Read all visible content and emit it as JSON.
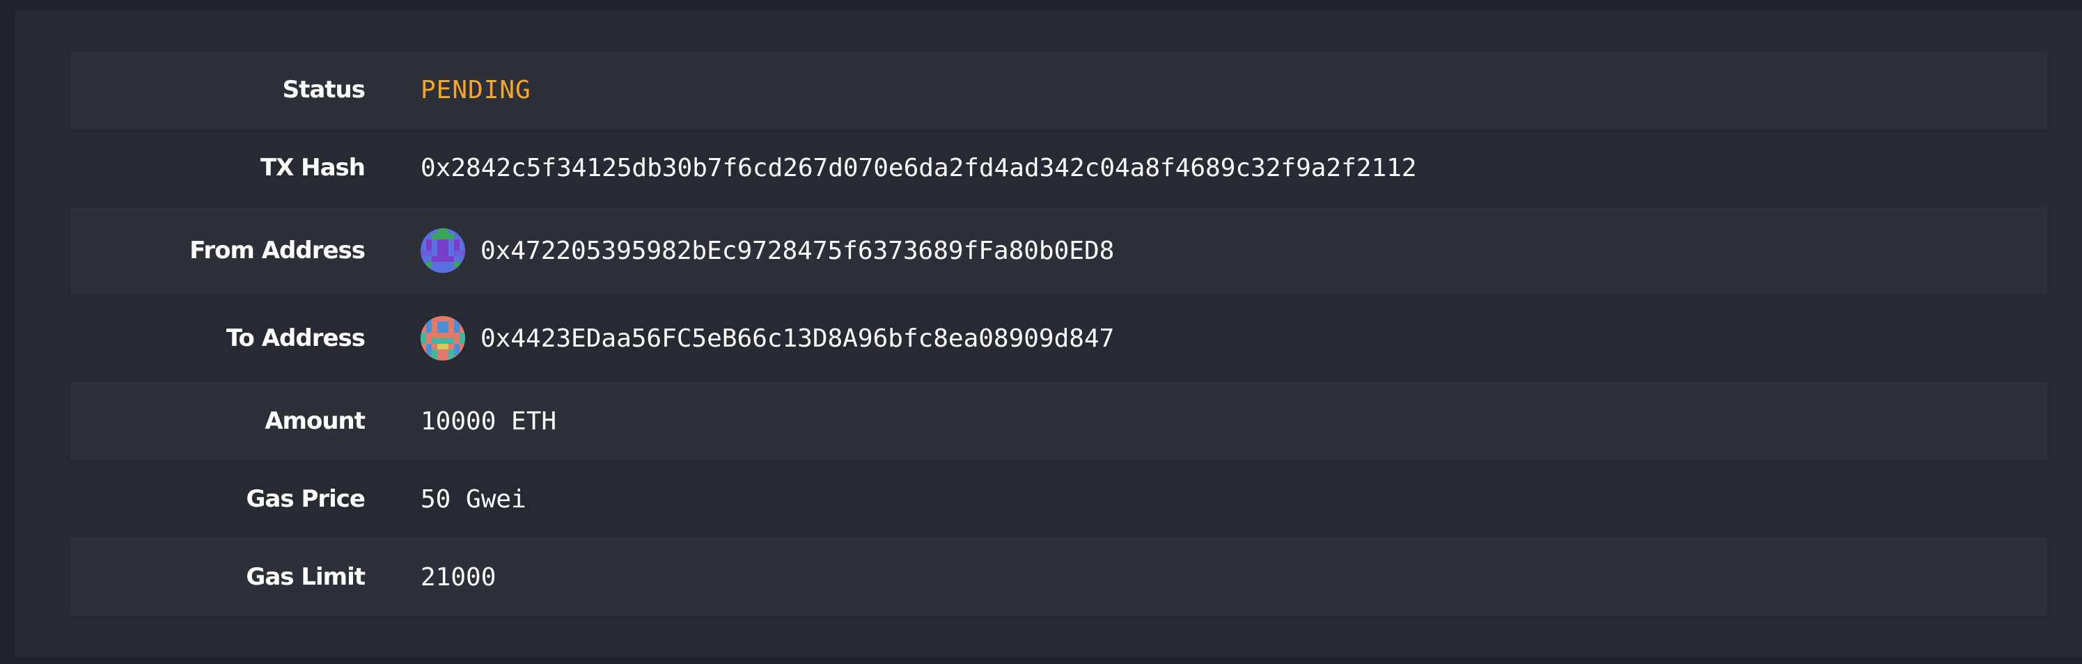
{
  "transaction": {
    "status": {
      "label": "Status",
      "value": "PENDING",
      "color": "#f5a623"
    },
    "tx_hash": {
      "label": "TX Hash",
      "value": "0x2842c5f34125db30b7f6cd267d070e6da2fd4ad342c04a8f4689c32f9a2f2112"
    },
    "from_address": {
      "label": "From Address",
      "value": "0x472205395982bEc9728475f6373689fFa80b0ED8",
      "avatar_icon": "identicon"
    },
    "to_address": {
      "label": "To Address",
      "value": "0x4423EDaa56FC5eB66c13D8A96bfc8ea08909d847",
      "avatar_icon": "identicon"
    },
    "amount": {
      "label": "Amount",
      "value": "10000 ETH"
    },
    "gas_price": {
      "label": "Gas Price",
      "value": "50 Gwei"
    },
    "gas_limit": {
      "label": "Gas Limit",
      "value": "21000"
    }
  }
}
